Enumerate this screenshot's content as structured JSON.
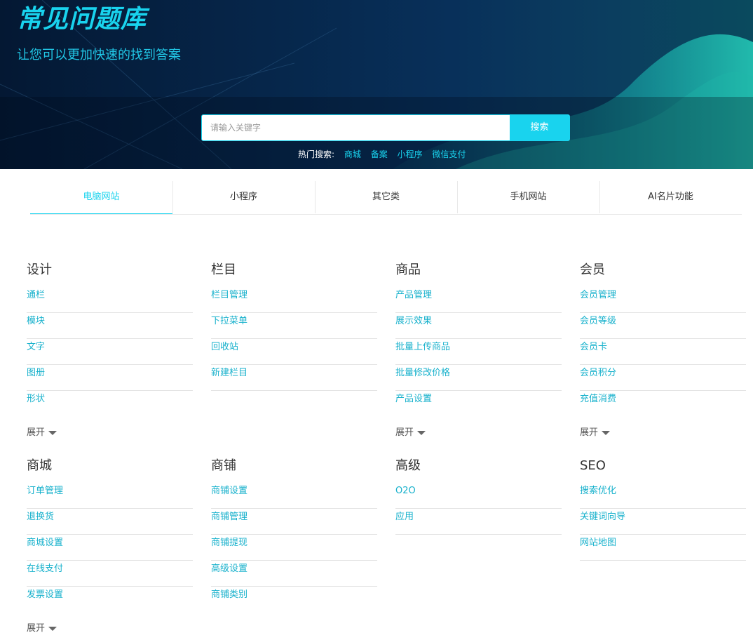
{
  "banner": {
    "title": "常见问题库",
    "subtitle": "让您可以更加快速的找到答案"
  },
  "search": {
    "placeholder": "请输入关键字",
    "button_label": "搜索",
    "hot_label": "热门搜索:",
    "hot_links": [
      "商城",
      "备案",
      "小程序",
      "微信支付"
    ]
  },
  "tabs": [
    {
      "label": "电脑网站",
      "active": true
    },
    {
      "label": "小程序",
      "active": false
    },
    {
      "label": "其它类",
      "active": false
    },
    {
      "label": "手机网站",
      "active": false
    },
    {
      "label": "AI名片功能",
      "active": false
    }
  ],
  "expand_label": "展开",
  "categories": [
    {
      "title": "设计",
      "items": [
        "通栏",
        "模块",
        "文字",
        "图册",
        "形状"
      ],
      "expandable": true
    },
    {
      "title": "栏目",
      "items": [
        "栏目管理",
        "下拉菜单",
        "回收站",
        "新建栏目"
      ],
      "expandable": false
    },
    {
      "title": "商品",
      "items": [
        "产品管理",
        "展示效果",
        "批量上传商品",
        "批量修改价格",
        "产品设置"
      ],
      "expandable": true
    },
    {
      "title": "会员",
      "items": [
        "会员管理",
        "会员等级",
        "会员卡",
        "会员积分",
        "充值消费"
      ],
      "expandable": true
    },
    {
      "title": "商城",
      "items": [
        "订单管理",
        "退换货",
        "商城设置",
        "在线支付",
        "发票设置"
      ],
      "expandable": true
    },
    {
      "title": "商铺",
      "items": [
        "商铺设置",
        "商铺管理",
        "商铺提现",
        "高级设置",
        "商铺类别"
      ],
      "expandable": false
    },
    {
      "title": "高级",
      "items": [
        "O2O",
        "应用"
      ],
      "expandable": false
    },
    {
      "title": "SEO",
      "items": [
        "搜索优化",
        "关键词向导",
        "网站地图"
      ],
      "expandable": false
    }
  ],
  "colors": {
    "accent": "#19d3ee",
    "link": "#17b1cc",
    "banner_bg": "#06264a"
  }
}
